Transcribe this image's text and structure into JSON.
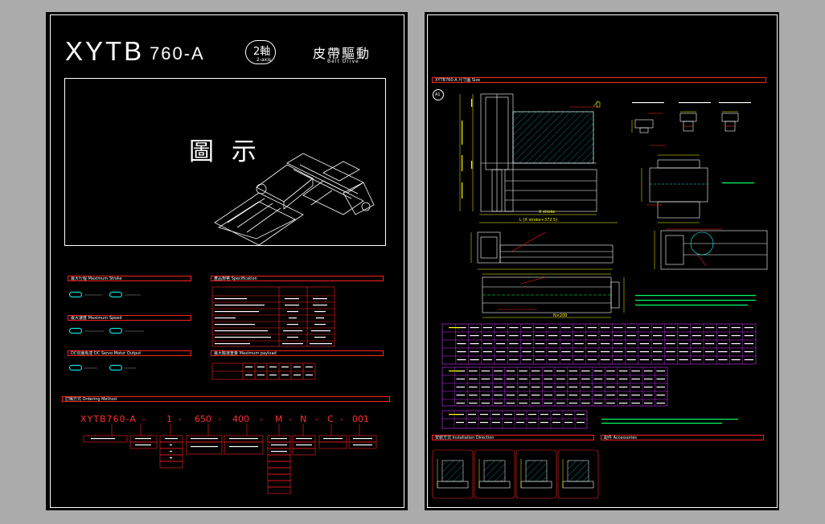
{
  "title": {
    "model": "XYTB",
    "number": "760-A",
    "axis_cn": "2軸",
    "axis_en": "2-axis",
    "drive_cn": "皮帶驅動",
    "drive_en": "Belt Drive"
  },
  "figure": {
    "caption": "圖 示"
  },
  "left_sections": {
    "max_stroke": "最大行程 Maximum Stroke",
    "max_speed": "最大速度 Maximum Speed",
    "max_output": "DC伺服馬達 DC Servo Motor Output",
    "spec": "產品規格 Specification",
    "payload": "最大搬運重量 Maximum payload",
    "ordering": "訂購方式 Ordering Method"
  },
  "ordering": {
    "code": [
      "XYTB760-A",
      "1",
      "650",
      "400",
      "M",
      "N",
      "C",
      "001"
    ]
  },
  "right_sections": {
    "size": "XYTB760-A 尺寸圖 Size",
    "circle_label": "A1",
    "installation": "安裝方式 Installation Direction",
    "accessories": "配件 Accessories",
    "x_stroke": "X stroke",
    "length_formula": "L (X stroke+372.5)",
    "dim_bottom": "N×200"
  },
  "colors": {
    "frame": "#ffffff",
    "header_border": "#ff2020",
    "table_border": "#cc33ff",
    "hatch": "#00cccc",
    "dimension": "#ffff00"
  }
}
